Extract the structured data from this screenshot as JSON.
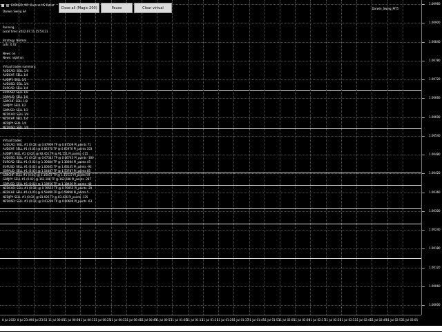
{
  "header": {
    "symbol_title": "EURUSD, M1: Euro vs US Dollar",
    "ea_name": "Darwin Swing EA",
    "badge": "Darwin_Swing_MT5"
  },
  "buttons": {
    "close_all": "Close all (Magic 200)",
    "pause": "Pause",
    "clear_virtual": "Clear virtual"
  },
  "info": {
    "status": "Running...",
    "local_time": "Local time: 2022.07.11 15:54:21",
    "strategy": "Strategy: Normal",
    "lots": "Lots: 0.02",
    "news_on": "News: on",
    "news_night": "News: night on",
    "summary_title": "Virtual trades summary:",
    "summary": [
      "AUDCAD: SELL 1/4",
      "AUDCHF: SELL 1/4",
      "AUDJPY: SELL 1/2",
      "AUDUSD: SELL 1/4",
      "EURCAD: SELL 1/4",
      "EURUSD: SELL 1/8",
      "GBPAUD: SELL 1/8",
      "GBPCHF: SELL 1/8",
      "GBPJPY: SELL 1/2",
      "GBPUSD: SELL 1/2",
      "NZDCAD: SELL 1/4",
      "NZDCHF: SELL 1/4",
      "NZDJPY: SELL 1/4",
      "NZDUSD: SELL 1/4"
    ],
    "trades_title": "Virtual trades:",
    "trades": [
      "AUDCAD: SELL #1 (0.02) @ 0.87909 TP @ 0.87509 Pl_points 71",
      "AUDCHF: SELL #1 (0.02) @ 0.66370 TP @ 0.65970 Pl_points 103",
      "AUDJPY: SELL #1 (0.02) @ 92.451 TP @ 91.551 Pl_points -115",
      "AUDUSD: SELL #1 (0.02) @ 0.67343 TP @ 0.66743 Pl_points -180",
      "EURCAD: SELL #1 (0.02) @ 1.30684 TP @ 1.30084 Pl_points 45",
      "EURUSD: SELL #1 (0.02) @ 1.00645 TP @ 1.00145 Pl_points -93",
      "GBPAUD: SELL #1 (0.02) @ 1.54487 TP @ 1.53787 Pl_points 85",
      "GBPCHF: SELL #1 (0.02) @ 1.16037 TP @ 1.15537 Pl_points 59",
      "GBPJPY: SELL #1 (0.02) @ 163.188 TP @ 162.688 Pl_points -287",
      "GBPUSD: SELL #1 (0.02) @ 1.18956 TP @ 1.18456 Pl_points -48",
      "NZDCAD: SELL #1 (0.02) @ 0.79555 TP @ 0.79055 Pl_points -29",
      "NZDCHF: SELL #1 (0.02) @ 0.59490 TP @ 0.58990 Pl_points 5",
      "NZDJPY: SELL #1 (0.02) @ 83.926 TP @ 83.426 Pl_points -125",
      "NZDUSD: SELL #1 (0.02) @ 0.61299 TP @ 0.60699 Pl_points -63"
    ]
  },
  "price_axis": [
    "1.00960",
    "1.00900",
    "1.00840",
    "1.00780",
    "1.00720",
    "1.00660",
    "1.00600",
    "1.00540",
    "1.00480",
    "1.00420",
    "1.00360",
    "1.00300",
    "1.00240",
    "1.00180",
    "1.00120",
    "1.00060",
    "1.00000"
  ],
  "time_axis": [
    "8 Jul 2022",
    "8 Jul 23:49",
    "8 Jul 23:53",
    "11 Jul 00:01",
    "11 Jul 00:09",
    "11 Jul 00:17",
    "11 Jul 00:25",
    "11 Jul 00:33",
    "11 Jul 00:41",
    "11 Jul 00:49",
    "11 Jul 00:57",
    "11 Jul 01:05",
    "11 Jul 01:13",
    "11 Jul 01:21",
    "11 Jul 01:29",
    "11 Jul 01:37",
    "11 Jul 01:45",
    "11 Jul 01:53",
    "11 Jul 02:01",
    "11 Jul 02:09",
    "11 Jul 02:17",
    "11 Jul 02:25",
    "11 Jul 02:33",
    "11 Jul 02:41",
    "11 Jul 02:49",
    "11 Jul 02:57",
    "11 Jul 03:05"
  ]
}
